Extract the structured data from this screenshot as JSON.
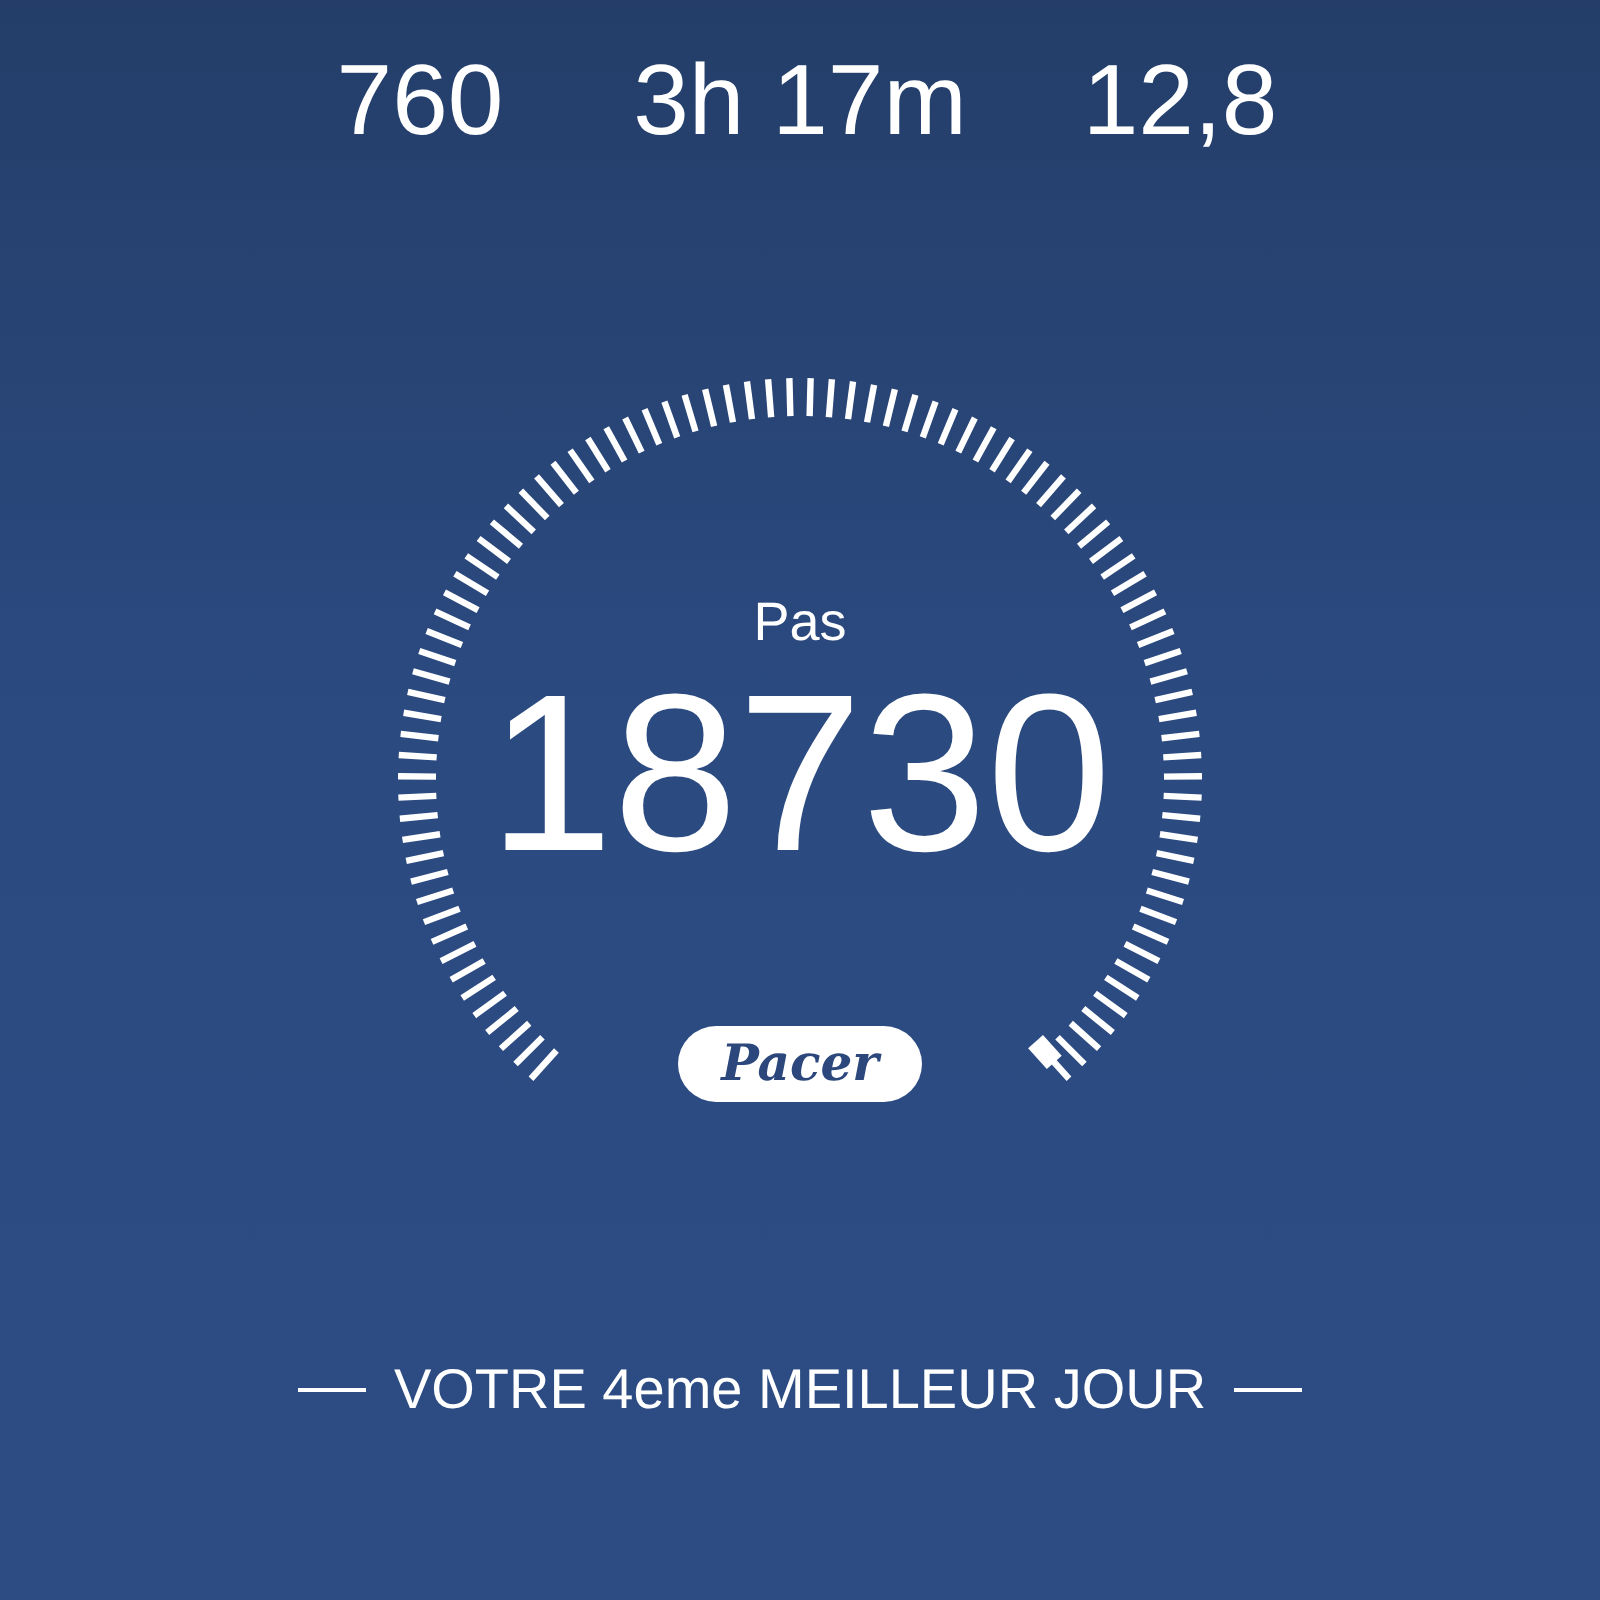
{
  "stats": [
    {
      "value": "760"
    },
    {
      "value": "3h 17m"
    },
    {
      "value": "12,8"
    }
  ],
  "steps": {
    "label": "Pas",
    "value": "18730"
  },
  "brand": "Pacer",
  "footer": {
    "text": "VOTRE 4eme MEILLEUR JOUR"
  }
}
